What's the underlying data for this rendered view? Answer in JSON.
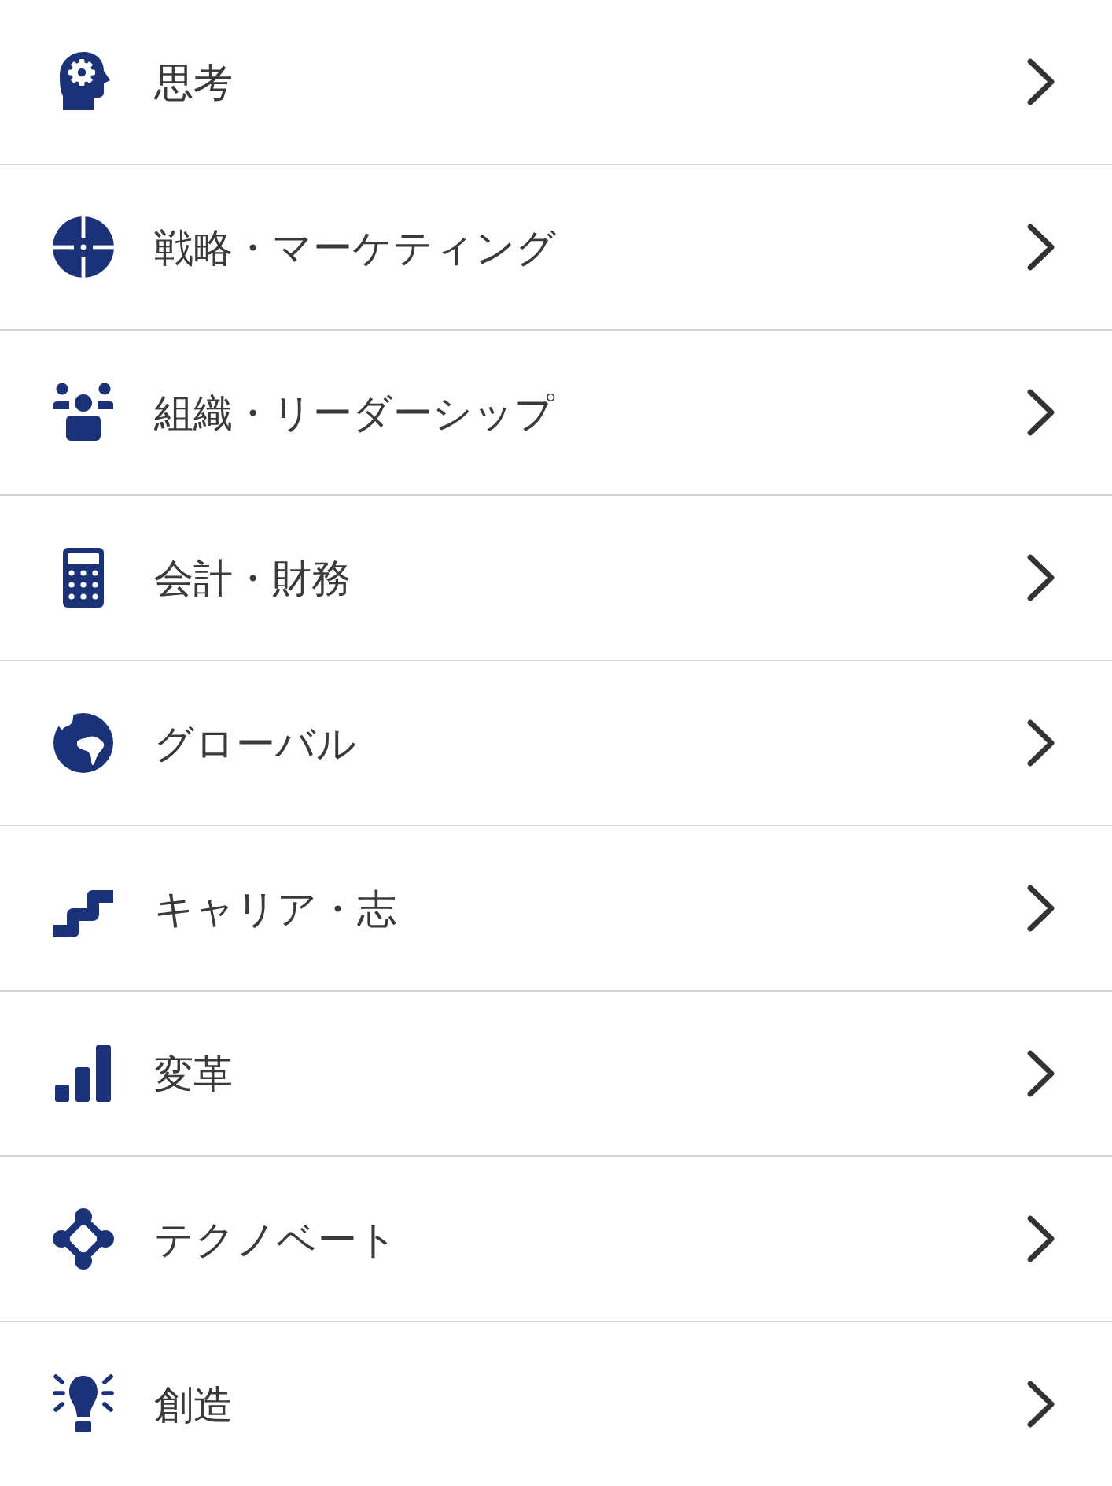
{
  "menu": {
    "items": [
      {
        "label": "思考"
      },
      {
        "label": "戦略・マーケティング"
      },
      {
        "label": "組織・リーダーシップ"
      },
      {
        "label": "会計・財務"
      },
      {
        "label": "グローバル"
      },
      {
        "label": "キャリア・志"
      },
      {
        "label": "変革"
      },
      {
        "label": "テクノベート"
      },
      {
        "label": "創造"
      }
    ]
  }
}
